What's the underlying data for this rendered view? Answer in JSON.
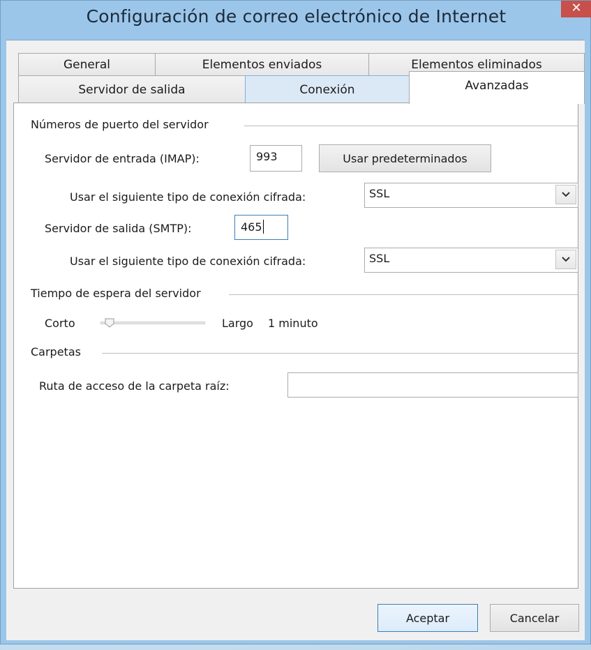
{
  "window": {
    "title": "Configuración de correo electrónico de Internet",
    "close_glyph": "✕"
  },
  "tabs": {
    "row1": [
      "General",
      "Elementos enviados",
      "Elementos eliminados"
    ],
    "row2": [
      "Servidor de salida",
      "Conexión",
      "Avanzadas"
    ],
    "active": "Avanzadas"
  },
  "ports": {
    "group_title": "Números de puerto del servidor",
    "incoming_label": "Servidor de entrada (IMAP):",
    "incoming_value": "993",
    "defaults_button": "Usar predeterminados",
    "incoming_encryption_label": "Usar el siguiente tipo de conexión cifrada:",
    "incoming_encryption_value": "SSL",
    "outgoing_label": "Servidor de salida (SMTP):",
    "outgoing_value": "465",
    "outgoing_encryption_label": "Usar el siguiente tipo de conexión cifrada:",
    "outgoing_encryption_value": "SSL"
  },
  "timeout": {
    "group_title": "Tiempo de espera del servidor",
    "short_label": "Corto",
    "long_label": "Largo",
    "value_text": "1 minuto",
    "level": 0
  },
  "folders": {
    "group_title": "Carpetas",
    "root_label": "Ruta de acceso de la carpeta raíz:",
    "root_value": ""
  },
  "buttons": {
    "ok": "Aceptar",
    "cancel": "Cancelar"
  },
  "icons": {
    "close": "close-icon",
    "dropdown": "chevron-down-icon",
    "slider": "slider-thumb-icon"
  },
  "colors": {
    "title_bar": "#9cc6e9",
    "close_button": "#c7504b",
    "focus_border": "#3c7fb1"
  }
}
